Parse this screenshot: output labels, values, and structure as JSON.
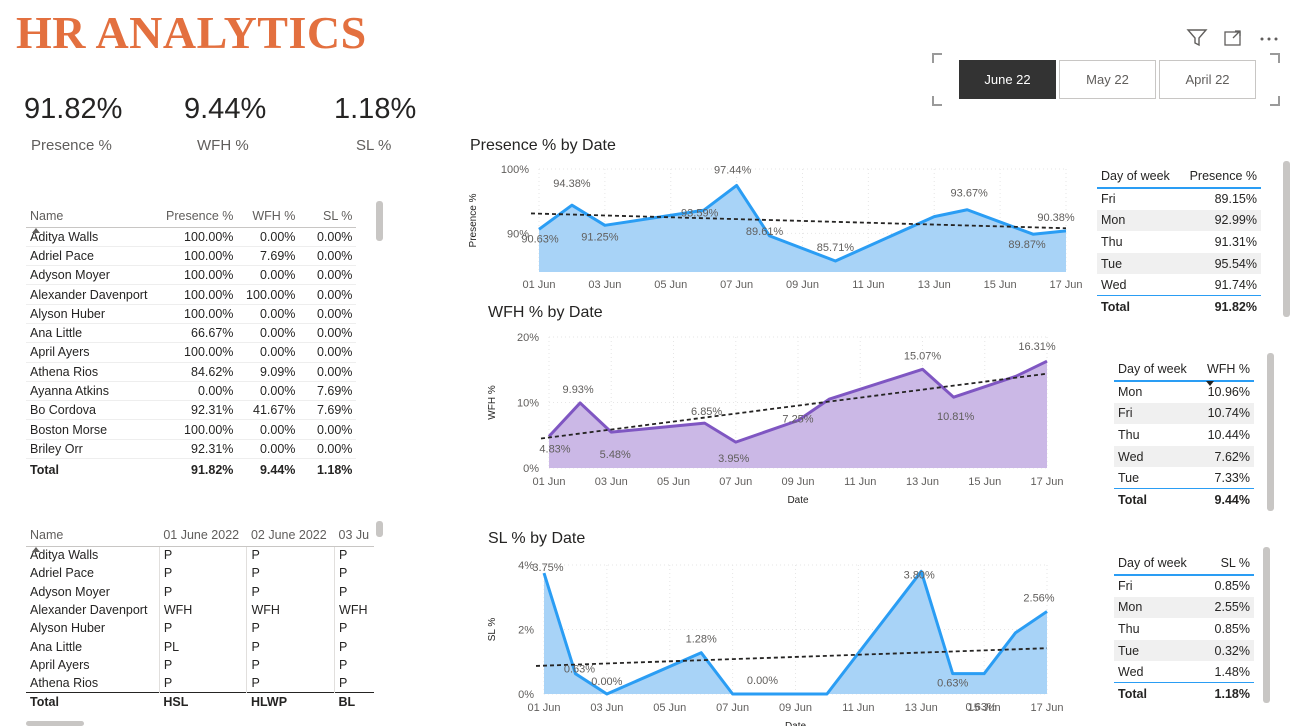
{
  "app": {
    "title": "HR ANALYTICS"
  },
  "toolbar": {
    "icons": [
      "filter-icon",
      "focus-mode-icon",
      "more-options-icon"
    ]
  },
  "slicer": {
    "options": [
      "June 22",
      "May 22",
      "April 22"
    ],
    "selected": "June 22"
  },
  "kpis": [
    {
      "value": "91.82%",
      "label": "Presence %"
    },
    {
      "value": "9.44%",
      "label": "WFH %"
    },
    {
      "value": "1.18%",
      "label": "SL %"
    }
  ],
  "employee_table": {
    "headers": [
      "Name",
      "Presence %",
      "WFH %",
      "SL %"
    ],
    "rows": [
      [
        "Aditya Walls",
        "100.00%",
        "0.00%",
        "0.00%"
      ],
      [
        "Adriel Pace",
        "100.00%",
        "7.69%",
        "0.00%"
      ],
      [
        "Adyson Moyer",
        "100.00%",
        "0.00%",
        "0.00%"
      ],
      [
        "Alexander Davenport",
        "100.00%",
        "100.00%",
        "0.00%"
      ],
      [
        "Alyson Huber",
        "100.00%",
        "0.00%",
        "0.00%"
      ],
      [
        "Ana Little",
        "66.67%",
        "0.00%",
        "0.00%"
      ],
      [
        "April Ayers",
        "100.00%",
        "0.00%",
        "0.00%"
      ],
      [
        "Athena Rios",
        "84.62%",
        "9.09%",
        "0.00%"
      ],
      [
        "Ayanna Atkins",
        "0.00%",
        "0.00%",
        "7.69%"
      ],
      [
        "Bo Cordova",
        "92.31%",
        "41.67%",
        "7.69%"
      ],
      [
        "Boston Morse",
        "100.00%",
        "0.00%",
        "0.00%"
      ],
      [
        "Briley Orr",
        "92.31%",
        "0.00%",
        "0.00%"
      ]
    ],
    "total": [
      "Total",
      "91.82%",
      "9.44%",
      "1.18%"
    ]
  },
  "attendance_matrix": {
    "headers": [
      "Name",
      "01 June 2022",
      "02 June 2022",
      "03 Ju"
    ],
    "rows": [
      [
        "Aditya Walls",
        "P",
        "P",
        "P"
      ],
      [
        "Adriel Pace",
        "P",
        "P",
        "P"
      ],
      [
        "Adyson Moyer",
        "P",
        "P",
        "P"
      ],
      [
        "Alexander Davenport",
        "WFH",
        "WFH",
        "WFH"
      ],
      [
        "Alyson Huber",
        "P",
        "P",
        "P"
      ],
      [
        "Ana Little",
        "PL",
        "P",
        "P"
      ],
      [
        "April Ayers",
        "P",
        "P",
        "P"
      ],
      [
        "Athena Rios",
        "P",
        "P",
        "P"
      ]
    ],
    "total": [
      "Total",
      "HSL",
      "HLWP",
      "BL"
    ]
  },
  "charts": {
    "presence": {
      "title": "Presence % by Date",
      "ylabel": "Presence %",
      "yticks": [
        "100%",
        "90%"
      ],
      "xticks": [
        "01 Jun",
        "03 Jun",
        "05 Jun",
        "07 Jun",
        "09 Jun",
        "11 Jun",
        "13 Jun",
        "15 Jun",
        "17 Jun"
      ]
    },
    "wfh": {
      "title": "WFH % by Date",
      "ylabel": "WFH %",
      "xlabel": "Date",
      "yticks": [
        "20%",
        "10%",
        "0%"
      ],
      "xticks": [
        "01 Jun",
        "03 Jun",
        "05 Jun",
        "07 Jun",
        "09 Jun",
        "11 Jun",
        "13 Jun",
        "15 Jun",
        "17 Jun"
      ]
    },
    "sl": {
      "title": "SL % by Date",
      "ylabel": "SL %",
      "xlabel": "Date",
      "yticks": [
        "4%",
        "2%",
        "0%"
      ],
      "xticks": [
        "01 Jun",
        "03 Jun",
        "05 Jun",
        "07 Jun",
        "09 Jun",
        "11 Jun",
        "13 Jun",
        "15 Jun",
        "17 Jun"
      ]
    }
  },
  "chart_data": [
    {
      "type": "area",
      "title": "Presence % by Date",
      "xlabel": "",
      "ylabel": "Presence %",
      "x": [
        1,
        2,
        3,
        6,
        7,
        8,
        10,
        13,
        14,
        16,
        17
      ],
      "values": [
        90.63,
        94.38,
        91.25,
        93.59,
        97.44,
        89.61,
        85.71,
        92.6,
        93.67,
        89.87,
        90.38
      ],
      "labels": [
        "90.63%",
        "94.38%",
        "91.25%",
        "93.59%",
        "97.44%",
        "89.61%",
        "85.71%",
        "",
        "93.67%",
        "89.87%",
        "90.38%"
      ],
      "ylim": [
        84,
        100
      ],
      "trendline": [
        93.1,
        90.8
      ],
      "color": "#2a9df4",
      "fill": "#a8d3f7"
    },
    {
      "type": "area",
      "title": "WFH % by Date",
      "xlabel": "Date",
      "ylabel": "WFH %",
      "x": [
        1,
        2,
        3,
        6,
        7,
        9,
        10,
        13,
        14,
        16,
        17
      ],
      "values": [
        4.83,
        9.93,
        5.48,
        6.85,
        3.95,
        7.25,
        10.5,
        15.07,
        10.81,
        14.0,
        16.31
      ],
      "labels": [
        "4.83%",
        "9.93%",
        "5.48%",
        "6.85%",
        "3.95%",
        "7.25%",
        "",
        "15.07%",
        "10.81%",
        "",
        "16.31%"
      ],
      "ylim": [
        0,
        20
      ],
      "trendline": [
        4.5,
        14.4
      ],
      "color": "#7f56c2",
      "fill": "#cbb8e6"
    },
    {
      "type": "area",
      "title": "SL % by Date",
      "xlabel": "Date",
      "ylabel": "SL %",
      "x": [
        1,
        2,
        3,
        6,
        7,
        9,
        10,
        13,
        14,
        15,
        16,
        17
      ],
      "values": [
        3.75,
        0.63,
        0.0,
        1.28,
        0.0,
        0.0,
        0.0,
        3.8,
        0.63,
        0.63,
        1.9,
        2.56
      ],
      "labels": [
        "3.75%",
        "0.63%",
        "0.00%",
        "1.28%",
        "",
        "0.00%",
        "",
        "3.80%",
        "0.63%",
        "0.63%",
        "",
        "2.56%"
      ],
      "ylim": [
        0,
        4
      ],
      "trendline": [
        0.87,
        1.42
      ],
      "color": "#2a9df4",
      "fill": "#a8d3f7"
    }
  ],
  "dow_tables": [
    {
      "headers": [
        "Day of week",
        "Presence %"
      ],
      "rows": [
        [
          "Fri",
          "89.15%"
        ],
        [
          "Mon",
          "92.99%"
        ],
        [
          "Thu",
          "91.31%"
        ],
        [
          "Tue",
          "95.54%"
        ],
        [
          "Wed",
          "91.74%"
        ]
      ],
      "total": [
        "Total",
        "91.82%"
      ]
    },
    {
      "headers": [
        "Day of week",
        "WFH %"
      ],
      "rows": [
        [
          "Mon",
          "10.96%"
        ],
        [
          "Fri",
          "10.74%"
        ],
        [
          "Thu",
          "10.44%"
        ],
        [
          "Wed",
          "7.62%"
        ],
        [
          "Tue",
          "7.33%"
        ]
      ],
      "total": [
        "Total",
        "9.44%"
      ]
    },
    {
      "headers": [
        "Day of week",
        "SL %"
      ],
      "rows": [
        [
          "Fri",
          "0.85%"
        ],
        [
          "Mon",
          "2.55%"
        ],
        [
          "Thu",
          "0.85%"
        ],
        [
          "Tue",
          "0.32%"
        ],
        [
          "Wed",
          "1.48%"
        ]
      ],
      "total": [
        "Total",
        "1.18%"
      ]
    }
  ]
}
